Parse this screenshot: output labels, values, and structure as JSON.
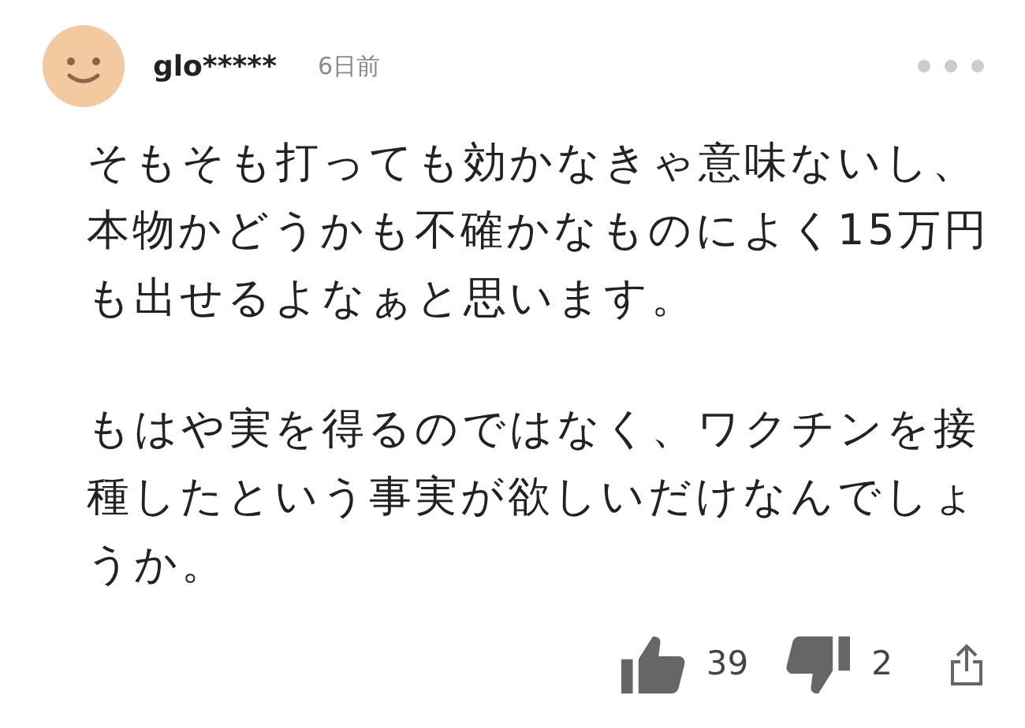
{
  "comment": {
    "user": "glo*****",
    "time": "6日前",
    "paragraphs": [
      "そもそも打っても効かなきゃ意味ないし、本物かどうかも不確かなものによく15万円も出せるよなぁと思います。",
      "もはや実を得るのではなく、ワクチンを接種したという事実が欲しいだけなんでしょうか。"
    ],
    "likes": "39",
    "dislikes": "2"
  }
}
